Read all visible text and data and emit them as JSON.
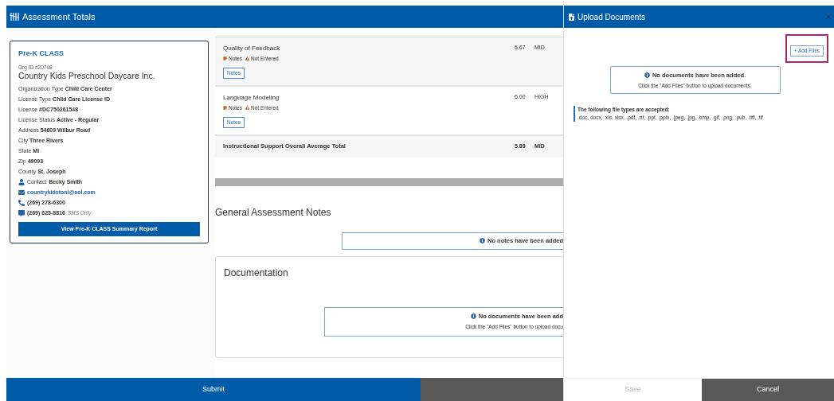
{
  "header": {
    "title": "Assessment Totals"
  },
  "org_card": {
    "program": "Pre-K CLASS",
    "org_id": "Org ID #20798",
    "name": "Country Kids Preschool Daycare Inc.",
    "fields": [
      {
        "label": "Organization Type",
        "value": "Child Care Center"
      },
      {
        "label": "License Type",
        "value": "Child Care License ID"
      },
      {
        "label": "License",
        "value": "#DC750261548"
      },
      {
        "label": "License Status",
        "value": "Active - Regular"
      },
      {
        "label": "Address",
        "value": "54609 Wilbur Road"
      },
      {
        "label": "City",
        "value": "Three Rivers"
      },
      {
        "label": "State",
        "value": "MI"
      },
      {
        "label": "Zip",
        "value": "49093"
      },
      {
        "label": "County",
        "value": "St. Joseph"
      }
    ],
    "contacts": [
      {
        "kind": "person",
        "label": "Contact",
        "value": "Becky Smith"
      },
      {
        "kind": "email",
        "value": "countrykidstoni@aol.com"
      },
      {
        "kind": "phone",
        "value": "(269) 278-6300"
      },
      {
        "kind": "sms",
        "value": "(269) 625-8816",
        "note": "SMS Only"
      }
    ],
    "report_button": "View Pre-K CLASS Summary Report"
  },
  "scores": [
    {
      "name": "Quality of Feedback",
      "notes_label": "Notes",
      "status": "Not Entered",
      "score": "5.67",
      "level": "MID",
      "button": "Notes"
    },
    {
      "name": "Language Modeling",
      "notes_label": "Notes",
      "status": "Not Entered",
      "score": "6.00",
      "level": "HIGH",
      "button": "Notes"
    }
  ],
  "total": {
    "label": "Instructional Support Overall Average Total",
    "score": "5.89",
    "level": "MID"
  },
  "general_notes": {
    "title": "General Assessment Notes",
    "empty": "No notes have been added"
  },
  "documentation": {
    "title": "Documentation",
    "empty": "No documents have been add",
    "hint": "Click the \"Add Files\" button to upload docu"
  },
  "footer": {
    "submit": "Submit"
  },
  "drawer": {
    "title": "Upload Documents",
    "add_button": "+ Add Files",
    "empty": "No documents have been added.",
    "hint": "Click the \"Add Files\" button to upload documents.",
    "types_title": "The following file types are accepted:",
    "types": ".doc, docx, .xls, xlsx, .pdf, .rtf, .ppt, .pptx, .jpeg, .jpg, .bmp, .gif, .png, .pub, .tiff, .tif",
    "save": "Save",
    "cancel": "Cancel"
  }
}
